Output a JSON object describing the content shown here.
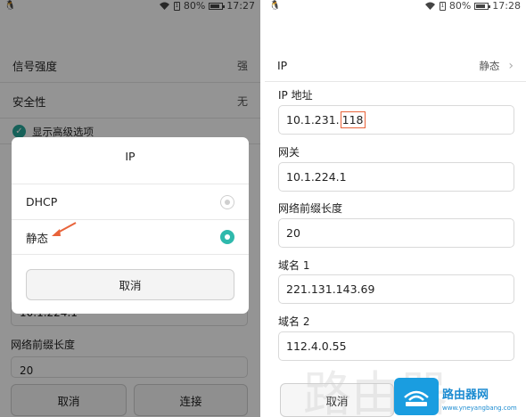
{
  "status_bar": {
    "left": {
      "battery_text": "80%",
      "time": "17:27"
    },
    "right": {
      "battery_text": "80%",
      "time": "17:28"
    },
    "battery_level": 0.8
  },
  "left": {
    "rows": {
      "signal": {
        "label": "信号强度",
        "value": "强"
      },
      "security": {
        "label": "安全性",
        "value": "无"
      },
      "advanced": {
        "label": "显示高级选项"
      }
    },
    "background_fields": {
      "gateway_value": "10.1.224.1",
      "prefix_label": "网络前缀长度",
      "prefix_value": "20"
    },
    "buttons": {
      "cancel": "取消",
      "connect": "连接"
    },
    "dialog": {
      "title": "IP",
      "options": [
        {
          "label": "DHCP",
          "selected": false
        },
        {
          "label": "静态",
          "selected": true
        }
      ],
      "cancel": "取消"
    }
  },
  "right": {
    "ip_mode": {
      "label": "IP",
      "value": "静态"
    },
    "fields": {
      "ip": {
        "label": "IP 地址",
        "value_prefix": "10.1.231.",
        "value_highlight": "118"
      },
      "gateway": {
        "label": "网关",
        "value": "10.1.224.1"
      },
      "prefix": {
        "label": "网络前缀长度",
        "value": "20"
      },
      "dns1": {
        "label": "域名 1",
        "value": "221.131.143.69"
      },
      "dns2": {
        "label": "域名 2",
        "value": "112.4.0.55"
      }
    },
    "buttons": {
      "cancel": "取消"
    }
  },
  "watermark": {
    "name": "路由器网",
    "url": "www.yneyangbang.com",
    "big_text": "路由器"
  },
  "colors": {
    "accent": "#2fb9ac",
    "annotation": "#e8633a",
    "watermark": "#1a9de0"
  }
}
